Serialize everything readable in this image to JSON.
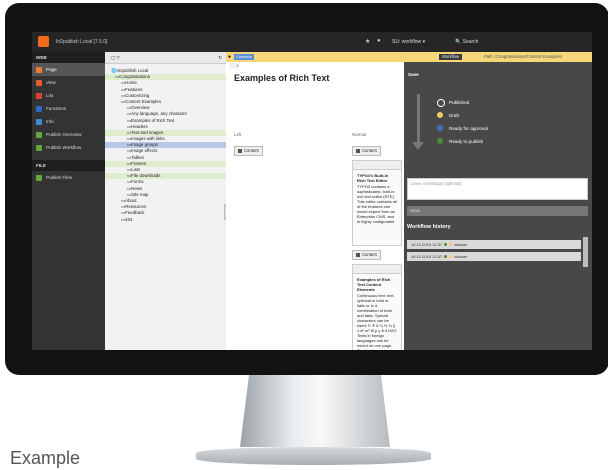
{
  "app": {
    "title": "In2publish Local [7.5.0]",
    "user": "SU: workflow",
    "search": "Search"
  },
  "menu": {
    "web_header": "WEB",
    "file_header": "FILE",
    "items": [
      {
        "label": "Page",
        "icon": "page-icon",
        "color": "#f07b2b"
      },
      {
        "label": "View",
        "icon": "view-icon",
        "color": "#e85d2c"
      },
      {
        "label": "List",
        "icon": "list-icon",
        "color": "#e0432e"
      },
      {
        "label": "Functions",
        "icon": "functions-icon",
        "color": "#2d6bc4"
      },
      {
        "label": "Info",
        "icon": "info-icon",
        "color": "#3c8ad6"
      },
      {
        "label": "Publish Overview",
        "icon": "publish-overview-icon",
        "color": "#62a83c"
      },
      {
        "label": "Publish Workflow",
        "icon": "publish-workflow-icon",
        "color": "#62a83c"
      }
    ],
    "file_items": [
      {
        "label": "Publish Files",
        "icon": "publish-files-icon",
        "color": "#62a83c"
      }
    ]
  },
  "tree": {
    "root": "In2publish Local",
    "nodes": [
      {
        "label": "Congratulations",
        "depth": 1,
        "state": "hl"
      },
      {
        "label": "Home",
        "depth": 2,
        "state": ""
      },
      {
        "label": "Features",
        "depth": 2,
        "state": ""
      },
      {
        "label": "Customizing",
        "depth": 2,
        "state": ""
      },
      {
        "label": "Content Examples",
        "depth": 2,
        "state": ""
      },
      {
        "label": "Overview",
        "depth": 3,
        "state": ""
      },
      {
        "label": "Any language, any character",
        "depth": 3,
        "state": ""
      },
      {
        "label": "Examples of Rich Text",
        "depth": 3,
        "state": ""
      },
      {
        "label": "Headers",
        "depth": 3,
        "state": ""
      },
      {
        "label": "Text and images",
        "depth": 3,
        "state": "hl"
      },
      {
        "label": "Images with links",
        "depth": 3,
        "state": ""
      },
      {
        "label": "Image groups",
        "depth": 3,
        "state": "sel"
      },
      {
        "label": "Image effects",
        "depth": 3,
        "state": ""
      },
      {
        "label": "Tables",
        "depth": 3,
        "state": ""
      },
      {
        "label": "Frames",
        "depth": 3,
        "state": "hl"
      },
      {
        "label": "Lists",
        "depth": 3,
        "state": ""
      },
      {
        "label": "File downloads",
        "depth": 3,
        "state": "hl"
      },
      {
        "label": "Forms",
        "depth": 3,
        "state": ""
      },
      {
        "label": "News",
        "depth": 3,
        "state": ""
      },
      {
        "label": "Site map",
        "depth": 3,
        "state": ""
      },
      {
        "label": "About",
        "depth": 2,
        "state": ""
      },
      {
        "label": "Resources",
        "depth": 2,
        "state": ""
      },
      {
        "label": "Feedback",
        "depth": 2,
        "state": ""
      },
      {
        "label": "404",
        "depth": 2,
        "state": ""
      }
    ]
  },
  "content": {
    "language_chip": "Columns",
    "title": "Examples of Rich Text",
    "col_left": "Left",
    "col_normal": "Normal",
    "content_btn": "Content",
    "ce1_title": "TYPO3's Built-in Rich Text Editor",
    "ce1_body": "TYPO3 contains a sophisticated, built-in rich text editor (RTE). This editor contains all of the features one would expect from an Enterprise CMS, and is highly configurable.",
    "ce2_title": "Examples of Rich Text Content Elements",
    "ce2_body": "Continuous text: text, optional in bold or italic or in a combination of bold and italic. Special characters can be used: © ® ß ¼ ½ ¾ § ± a² m³ Ø µ ç å ö H2O Texts in foreign languages can be mixed on one page. The font has to be installed on the device though:"
  },
  "workflow": {
    "button": "Workflow",
    "path": "Path: /Congratulations/Content Examples/",
    "save": "Save",
    "states": [
      {
        "label": "Published",
        "color": "#ffffff"
      },
      {
        "label": "Draft",
        "color": "#f5c96a"
      },
      {
        "label": "Ready for approval",
        "color": "#3f6fb8"
      },
      {
        "label": "Ready to publish",
        "color": "#4f8c3a"
      }
    ],
    "message_placeholder": "Leave a message (optional)",
    "save_button": "Save",
    "history_title": "Workflow history",
    "history": [
      {
        "date": "16.10.2015 12:37",
        "user": "afesser"
      },
      {
        "date": "16.10.2015 12:37",
        "user": "afesser"
      }
    ]
  },
  "caption": "Example"
}
